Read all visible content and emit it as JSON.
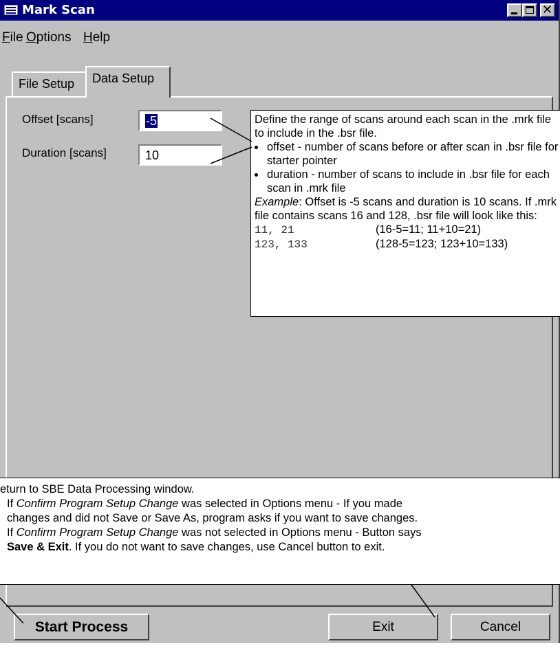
{
  "window": {
    "title": "Mark Scan"
  },
  "menu": {
    "file": {
      "ul": "F",
      "rest": "ile"
    },
    "options": {
      "ul": "O",
      "rest": "ptions"
    },
    "help": {
      "ul": "H",
      "rest": "elp"
    }
  },
  "tabs": {
    "file_setup": "File Setup",
    "data_setup": "Data Setup"
  },
  "fields": {
    "offset_label": "Offset [scans]",
    "offset_value": "-5",
    "duration_label": "Duration [scans]",
    "duration_value": "10"
  },
  "callout": {
    "intro": "Define the range of scans around each scan in the .mrk file to include in the .bsr file.",
    "bullets": [
      "offset - number of scans before or after scan in .bsr file for starter pointer",
      "duration - number of scans to include in .bsr file for each scan in .mrk file"
    ],
    "example_label": "Example",
    "example_text": ": Offset is -5 scans and duration is 10 scans. If .mrk file contains scans 16 and 128, .bsr file will look like this:",
    "rows": [
      {
        "code": "11, 21",
        "calc": "(16-5=11; 11+10=21)"
      },
      {
        "code": "123, 133",
        "calc": "(128-5=123; 123+10=133)"
      }
    ]
  },
  "band": {
    "line1": "eturn to SBE Data Processing window.",
    "line2_pre": "If ",
    "line2_em": "Confirm Program Setup Change",
    "line2_post": " was selected in Options menu - If you made",
    "line3": "changes and did not Save or Save As, program asks if you want to save changes.",
    "line4_pre": "If ",
    "line4_em": "Confirm Program Setup Change",
    "line4_post": " was not selected in Options menu - Button says",
    "line5_bold": "Save & Exit",
    "line5_post": ". If you do not want to save changes, use Cancel button to exit."
  },
  "buttons": {
    "start": "Start Process",
    "exit": "Exit",
    "cancel": "Cancel"
  }
}
